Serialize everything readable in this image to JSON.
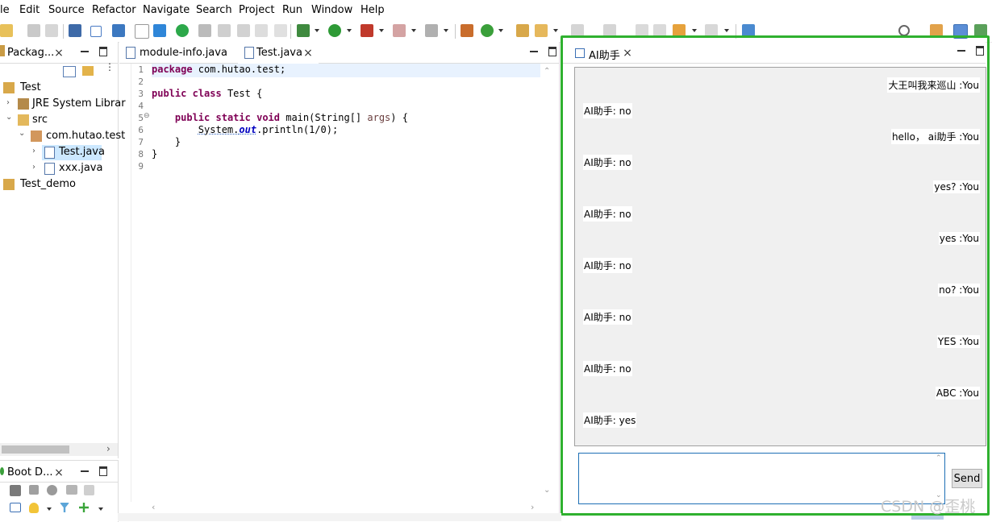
{
  "menu": [
    "le",
    "Edit",
    "Source",
    "Refactor",
    "Navigate",
    "Search",
    "Project",
    "Run",
    "Window",
    "Help"
  ],
  "package_explorer": {
    "tab_title": "Packag...",
    "tree": [
      {
        "label": "Test"
      },
      {
        "label": "JRE System Librar"
      },
      {
        "label": "src"
      },
      {
        "label": "com.hutao.test"
      },
      {
        "label": "Test.java"
      },
      {
        "label": "xxx.java"
      },
      {
        "label": "Test_demo"
      }
    ]
  },
  "boot_dashboard": {
    "tab_title": "Boot D..."
  },
  "editor": {
    "tabs": [
      {
        "label": "module-info.java"
      },
      {
        "label": "Test.java"
      }
    ],
    "line_numbers": [
      "1",
      "2",
      "3",
      "4",
      "5",
      "6",
      "7",
      "8",
      "9"
    ]
  },
  "ai_view": {
    "tab_title": "AI助手",
    "messages": [
      {
        "from": "user",
        "text": "大王叫我来巡山 :You"
      },
      {
        "from": "ai",
        "text": "AI助手: no"
      },
      {
        "from": "user",
        "text": "hello， ai助手 :You"
      },
      {
        "from": "ai",
        "text": "AI助手: no"
      },
      {
        "from": "user",
        "text": "yes?  :You"
      },
      {
        "from": "ai",
        "text": "AI助手: no"
      },
      {
        "from": "user",
        "text": "yes :You"
      },
      {
        "from": "ai",
        "text": "AI助手: no"
      },
      {
        "from": "user",
        "text": "no? :You"
      },
      {
        "from": "ai",
        "text": "AI助手: no"
      },
      {
        "from": "user",
        "text": "YES :You"
      },
      {
        "from": "ai",
        "text": "AI助手: no"
      },
      {
        "from": "user",
        "text": "ABC :You"
      },
      {
        "from": "ai",
        "text": "AI助手: yes"
      }
    ],
    "input_value": "",
    "send_label": "Send"
  },
  "watermark": "CSDN @歪桃",
  "colors": {
    "highlight_frame": "#2fb12f",
    "keyword": "#7f0055",
    "field": "#0000c0"
  }
}
